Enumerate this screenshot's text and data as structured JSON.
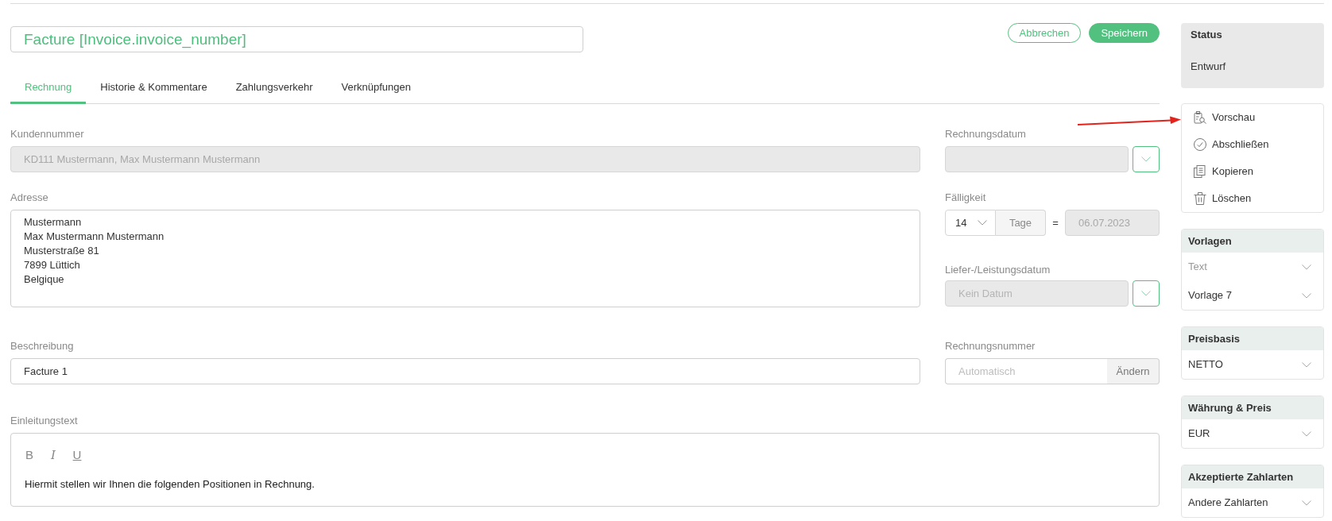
{
  "header": {
    "title": "Facture [Invoice.invoice_number]",
    "buttons": [
      {
        "label": "Abbrechen",
        "kind": "cancel"
      },
      {
        "label": "Speichern",
        "kind": "save"
      }
    ]
  },
  "tabs": [
    {
      "label": "Rechnung",
      "selected": true
    },
    {
      "label": "Historie & Kommentare",
      "selected": false
    },
    {
      "label": "Zahlungsverkehr",
      "selected": false
    },
    {
      "label": "Verknüpfungen",
      "selected": false
    }
  ],
  "form": {
    "customer": {
      "label": "Kundennummer",
      "value": "KD111 Mustermann, Max Mustermann Mustermann",
      "disabled": true
    },
    "address": {
      "label": "Adresse",
      "lines": [
        "Mustermann",
        "Max Mustermann Mustermann",
        "Musterstraße 81",
        "7899 Lüttich",
        "Belgique"
      ]
    },
    "description": {
      "label": "Beschreibung",
      "value": "Facture 1"
    },
    "intro": {
      "label": "Einleitungstext",
      "toolbar": [
        {
          "label": "B",
          "kind": "bold"
        },
        {
          "label": "I",
          "kind": "italic"
        },
        {
          "label": "U",
          "kind": "underline"
        }
      ],
      "text": "Hiermit stellen wir Ihnen die folgenden Positionen in Rechnung."
    }
  },
  "dates": {
    "invoice_date": {
      "label": "Rechnungsdatum",
      "disabled": true
    },
    "due": {
      "label": "Fälligkeit",
      "days": "14",
      "unit": "Tage",
      "equals": "=",
      "date": "06.07.2023",
      "disabled": true
    },
    "delivery_date": {
      "label": "Liefer-/Leistungsdatum",
      "placeholder": "Kein Datum",
      "disabled": true
    },
    "invoice_number": {
      "label": "Rechnungsnummer",
      "placeholder": "Automatisch",
      "button": "Ändern"
    }
  },
  "sidebar": {
    "status": {
      "title": "Status",
      "value": "Entwurf"
    },
    "actions": [
      {
        "label": "Vorschau",
        "kind": "preview"
      },
      {
        "label": "Abschließen",
        "kind": "complete"
      },
      {
        "label": "Kopieren",
        "kind": "copy"
      },
      {
        "label": "Löschen",
        "kind": "delete"
      }
    ],
    "panels": [
      {
        "title": "Vorlagen",
        "selects": [
          {
            "placeholder": "Text"
          },
          {
            "value": "Vorlage 7"
          }
        ]
      },
      {
        "title": "Preisbasis",
        "selects": [
          {
            "value": "NETTO"
          }
        ]
      },
      {
        "title": "Währung & Preis",
        "selects": [
          {
            "value": "EUR"
          }
        ]
      },
      {
        "title": "Akzeptierte Zahlarten",
        "selects": [
          {
            "value": "Andere Zahlarten"
          }
        ]
      }
    ]
  }
}
